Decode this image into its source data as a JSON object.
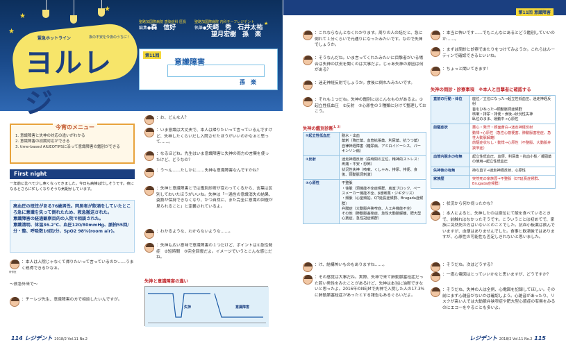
{
  "left": {
    "logo": {
      "small": "緊急ホットライン",
      "main": "ヨルレジ",
      "sub": "夜の不安を今夜のうちに！"
    },
    "editors": {
      "edit_tag": "聖路加国際病院 感染症科 医長",
      "edit_label": "編集●",
      "edit_name": "森　信好",
      "write_tag": "聖路加国際病院 内科チーフレジデント",
      "write_label": "執筆●",
      "write_names_1": "矢崎　秀　石井太祐",
      "write_names_2": "望月宏樹　孫　楽"
    },
    "card": {
      "round": "第11回",
      "title": "意識障害",
      "author": "孫　楽"
    },
    "menu": {
      "title": "今宵のメニュー",
      "items": [
        "1. 意識障害と失神の対応の違いがわかる",
        "2. 意識障害の初期対応ができる",
        "3. time-based AIUEOTIPSに沿って意識障害の鑑別ができる"
      ]
    },
    "first_night": {
      "title": "First night",
      "intro": "一年前に比べて少し寒くなってきました。今日も病棟は忙しそうです。夜になるとさらに忙しくなりそうな気配がしています。"
    },
    "case": [
      "高血圧の既往がある76歳男性。同居者が飲酒をしていたところ急に意識を失って倒れたため、救急搬送された。",
      "意識障害の経過観察目的の入院で相談された。",
      "意識清明、体温36.2℃、血圧120/80mmHg、脈拍55回/分・整、呼吸数16回/分、SpO2 98%(room air)。"
    ],
    "bubble1": "：本人は入院じゃなくて帰りたいって言っているのか……うまく説得できるかなぁ。",
    "bubble1_label": "研修医",
    "ed_line": "〜救急外来で〜",
    "bubble2": "：チーレジ先生、意識障害の方で相談したいんですが。",
    "col2": [
      "：お、どんな人？",
      "：いま意識は大丈夫で、本人は帰りたいって言っているんですけど、失神したくらいだし入院させたほうがいいのかなぁと思って……。",
      "：なるほどね。先生はいま意識障害と失神の両方の言葉を使ったけど、どうなの？",
      "：う〜ん……たしかに……失神も意識障害なんですかね？",
      "：失神と意識障害とでは鑑別診断が変わってくるから、言葉は区別しておいたほうがいいね。失神は「一過性の意識消失の結果、姿勢が保持できなくなり、かつ自然に、また完全に意識の回復が見られること」と定義されているよ。",
      "：わかるような、わからないような……。",
      "：失神も広い意味で意識障害の１つだけど、ポイントは①急性発症　②短時間　③完全回復だよ。イメージでいうとこんな感じだね。"
    ],
    "graph": {
      "title": "失神と意識障害の違い",
      "syncope": "失神",
      "coma": "意識障害"
    },
    "footer": {
      "page": "114",
      "journal": "レジデント",
      "issue": "2018/2  Vol.11 No.2"
    }
  },
  "right": {
    "header_tag": "第11回  意識障害",
    "col1": [
      "：これならなんとなくわかります。周りの人の話だと、急に倒れて１分くらいで元通りになったみたいです。なので失神でしょうか。",
      "：そうなんだね。いま言ってくれたみたいに目撃者がいる場合は失神の状況を聞くのは大事だよ。じゃあ失神の原因は何がある？",
      "：迷走神経反射でしょうか。食後に倒れたみたいです。",
      "：それも１つだね。失神の鑑別にはこんなものがあるよ。①起立性低血圧　②反射　③心原性の３種類に分けて整理しておこう。"
    ],
    "ddx_title": "失神の鑑別診断",
    "ddx": [
      {
        "cat": "①起立性低血圧",
        "desc": "脱水・出血\n薬剤（降圧薬、血管拡張薬、利尿薬、抗うつ薬）\n自律神経障害（糖尿病、アミロイドーシス、パーキンソン病）"
      },
      {
        "cat": "②反射",
        "desc": "迷走神経反射（長時間の立位、精神的ストレス：疼痛・不安・恐怖）\n状況性失神（咳嗽、くしゃみ、排尿、排便、食後、頸動脈洞刺激）"
      },
      {
        "cat": "③心原性",
        "desc": "不整脈\n・徐脈（洞機能不全症候群、房室ブロック、ペースメーカー機能不全、β遮断薬・ジギタリス）\n・頻脈（心室頻拍、QT延長症候群、Brugada症候群）\n弁膜症（大動脈弁狭窄症、人工弁機能不全）\nその他（肺動脈塞栓症、急性大動脈解離、肥大型心筋症、急性冠症候群）"
      }
    ],
    "col1_bottom": [
      "：け、結構怖いものもありますね……。",
      "：その感覚は大事だね。実際、失神で来て肺動脈塞栓症だった若い男性をみたことがあるけど、失神は本当に油断できないと思ったよ。2016年のNEJMで失神で入院した人の17.3%に肺動脈塞栓症があったとする報告もあるぐらいだよ。"
    ],
    "col2": [
      "：本当に怖いです……でもこんなにあるとどう鑑別していいのか……。",
      "：まずは問診と診察であたりをつけてみようか。これらはルーティンで確認できるといいね。",
      "：ちょっと聞いてきます！"
    ],
    "tbl2_title": "失神の問診・診察事項　※本人と目撃者に確認する",
    "tbl2": [
      {
        "cat": "直前の行動・体位",
        "desc": "座位／立位になった→起立性低血圧、迷走神経反射\n首をひねった→頸動脈洞症候群\n咳嗽・排尿・排便・食後→状況性失神\n臥位のまま、運動中→心原性"
      },
      {
        "cat": "前駆症状",
        "desc": "悪心・発汗・顔面蒼白→迷走神経反射\n動悸→心原性（急性心筋梗塞、肺動脈塞栓症、急性大動脈解離）\n前駆症状なし・動悸→心原性（不整脈、大動脈弁狭窄症）"
      },
      {
        "cat": "血管内脱水の有無",
        "desc": "起立性低血圧、血便、利尿薬・抗血小板／凝固薬の使用→起立性低血圧"
      },
      {
        "cat": "失神後の有無",
        "desc": "持ち直す→迷走神経反射、心原性"
      },
      {
        "cat": "家族歴",
        "desc": "突然死の家族歴→不整脈（QT延長症候群、Brugada症候群）"
      }
    ],
    "col2_bottom": [
      "：状況から何か伺ったかな？",
      "：本人によると、失神したのは座位にて飯を食べているときで、前触れはなかったそうです。こういうことは初めてで、家族に突然死の方はいないとのことでした。抗血小板薬は飲んでいますが、血便はありませんでした。食事と飲酒後ではありますが、心原性の可能性も否定しきれないと思いました。",
      "：そうだね。次はどうする？",
      "：一度心電図はとっていいかなと思いますが、どうですか？",
      "：そうだね、失神の人は全例、心電図を記録してほしい。その前にまず心雑音がないかは確認しよう。心雑音があったり、リスクが高い人では大動脈弁狭窄症や肥大型心筋症の有無をみるのにエコーをやることも多いよ。"
    ],
    "footer": {
      "page": "115",
      "journal": "レジデント",
      "issue": "2018/2  Vol.11 No.2"
    }
  },
  "colors": {
    "navy": "#1b3f80",
    "yellow": "#f5d83a",
    "red": "#c0282c",
    "lightblue": "#e5f2fb"
  }
}
